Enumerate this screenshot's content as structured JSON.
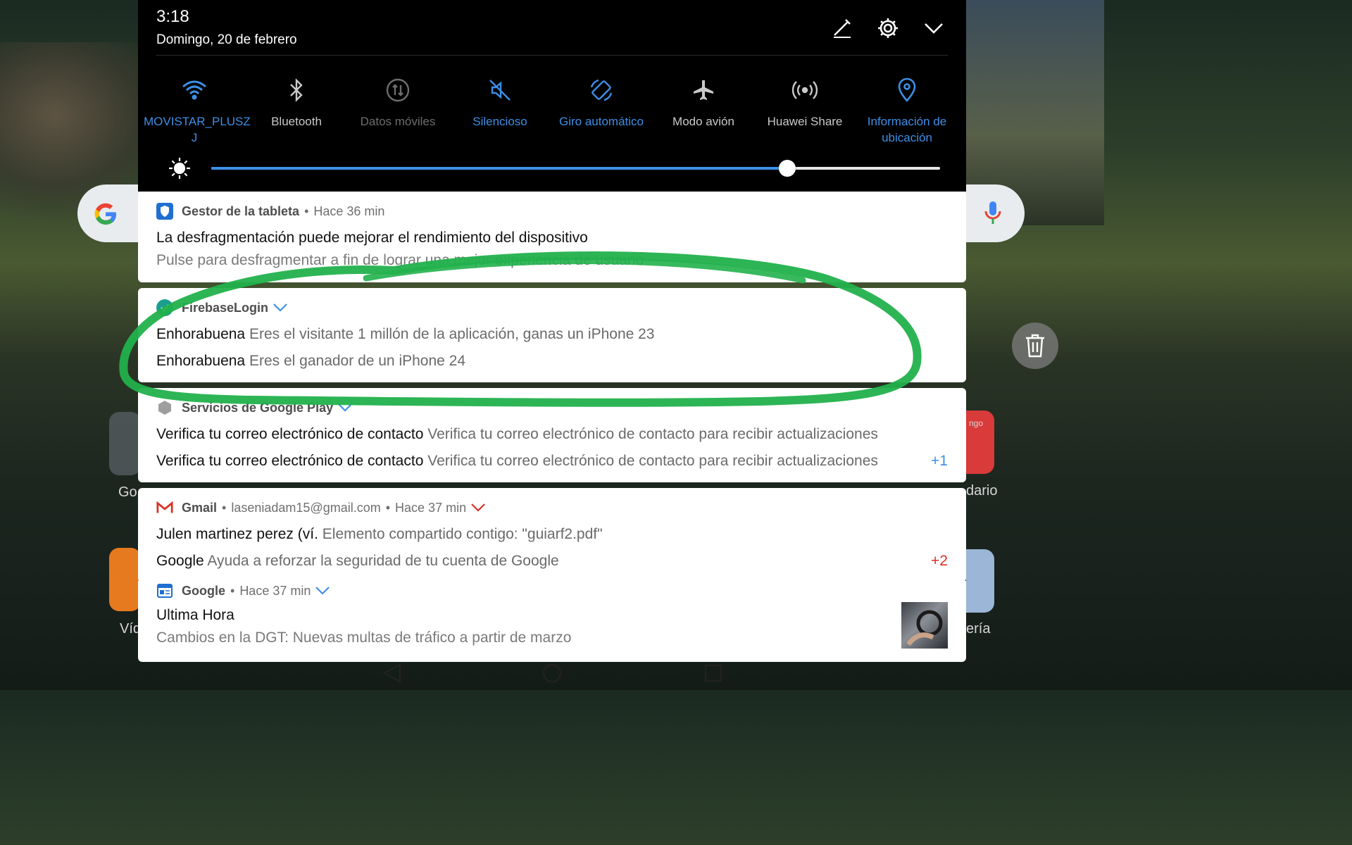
{
  "status": {
    "time": "3:18",
    "date": "Domingo, 20 de febrero"
  },
  "header_icons": [
    "edit-icon",
    "settings-icon",
    "collapse-chevron-icon"
  ],
  "quick_settings": [
    {
      "icon": "wifi-icon",
      "label": "MOVISTAR_PLUSZ J",
      "state": "on"
    },
    {
      "icon": "bluetooth-icon",
      "label": "Bluetooth",
      "state": "off"
    },
    {
      "icon": "mobile-data-icon",
      "label": "Datos móviles",
      "state": "disabled"
    },
    {
      "icon": "silent-icon",
      "label": "Silencioso",
      "state": "on"
    },
    {
      "icon": "auto-rotate-icon",
      "label": "Giro automático",
      "state": "on"
    },
    {
      "icon": "airplane-icon",
      "label": "Modo avión",
      "state": "off"
    },
    {
      "icon": "huawei-share-icon",
      "label": "Huawei Share",
      "state": "off"
    },
    {
      "icon": "location-icon",
      "label": "Información de ubicación",
      "state": "on"
    }
  ],
  "brightness": {
    "level": 0.79
  },
  "notifications": [
    {
      "app": "Gestor de la tableta",
      "time": "Hace 36 min",
      "title": "La desfragmentación puede mejorar el rendimiento del dispositivo",
      "text": "Pulse para desfragmentar a fin de lograr una mejor experiencia de usuario"
    },
    {
      "app": "FirebaseLogin",
      "messages": [
        {
          "title": "Enhorabuena",
          "text": "Eres el visitante 1 millón de la aplicación, ganas un iPhone 23"
        },
        {
          "title": "Enhorabuena",
          "text": "Eres el ganador de un iPhone 24"
        }
      ]
    },
    {
      "app": "Servicios de Google Play",
      "messages": [
        {
          "title": "Verifica tu correo electrónico de contacto",
          "text": "Verifica tu correo electrónico de contacto para recibir actualizaciones"
        },
        {
          "title": "Verifica tu correo electrónico de contacto",
          "text": "Verifica tu correo electrónico de contacto para recibir actualizaciones"
        }
      ],
      "more": "+1"
    },
    {
      "app": "Gmail",
      "account": "laseniadam15@gmail.com",
      "time": "Hace 37 min",
      "messages": [
        {
          "title": "Julen martinez perez (ví.",
          "text": "Elemento compartido contigo: \"guiarf2.pdf\""
        },
        {
          "title": "Google",
          "text": "Ayuda a reforzar la seguridad de tu cuenta de Google"
        }
      ],
      "more": "+2"
    },
    {
      "app": "Google",
      "time": "Hace 37 min",
      "title": "Ultima Hora",
      "text": "Cambios en la DGT: Nuevas multas de tráfico a partir de marzo"
    }
  ],
  "background_labels": {
    "left_app_1": "Go",
    "left_app_2": "Víd",
    "right_app_1": "dario",
    "right_app_2": "ería",
    "right_app_1_top": "ngo"
  },
  "colors": {
    "accent": "#3d8fe6",
    "annotation_stroke": "#22b14c",
    "gmail_red": "#d93025"
  }
}
